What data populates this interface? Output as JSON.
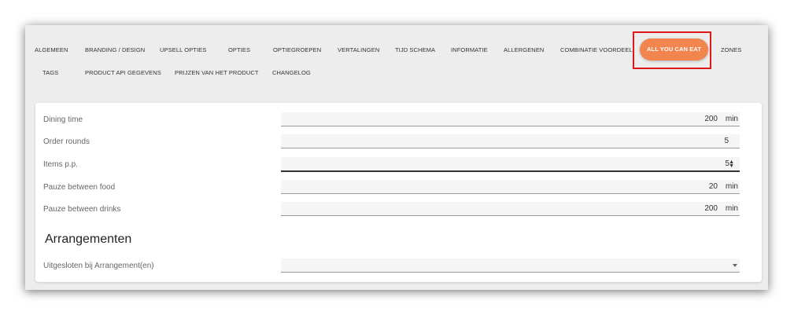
{
  "tabs": {
    "row1": [
      "ALGEMEEN",
      "BRANDING / DESIGN",
      "UPSELL OPTIES",
      "OPTIES",
      "OPTIEGROEPEN",
      "VERTALINGEN",
      "TIJD SCHEMA",
      "INFORMATIE",
      "ALLERGENEN",
      "COMBINATIE VOORDEEL",
      "ALL YOU CAN EAT",
      "ZONES"
    ],
    "row2": [
      "TAGS",
      "PRODUCT API GEGEVENS",
      "PRIJZEN VAN HET PRODUCT",
      "CHANGELOG"
    ],
    "active": "ALL YOU CAN EAT"
  },
  "colors": {
    "accent": "#f2844e",
    "highlight_border": "#e01818"
  },
  "form": {
    "dining_time": {
      "label": "Dining time",
      "value": "200",
      "unit": "min"
    },
    "order_rounds": {
      "label": "Order rounds",
      "value": "5"
    },
    "items_pp": {
      "label": "Items p.p.",
      "value": "5"
    },
    "pauze_food": {
      "label": "Pauze between food",
      "value": "20",
      "unit": "min"
    },
    "pauze_drinks": {
      "label": "Pauze between drinks",
      "value": "200",
      "unit": "min"
    }
  },
  "arrangementen": {
    "title": "Arrangementen",
    "excluded_label": "Uitgesloten bij Arrangement(en)",
    "excluded_value": ""
  },
  "icons": {
    "spinner": "spinner-icon",
    "dropdown": "caret-down-icon"
  }
}
